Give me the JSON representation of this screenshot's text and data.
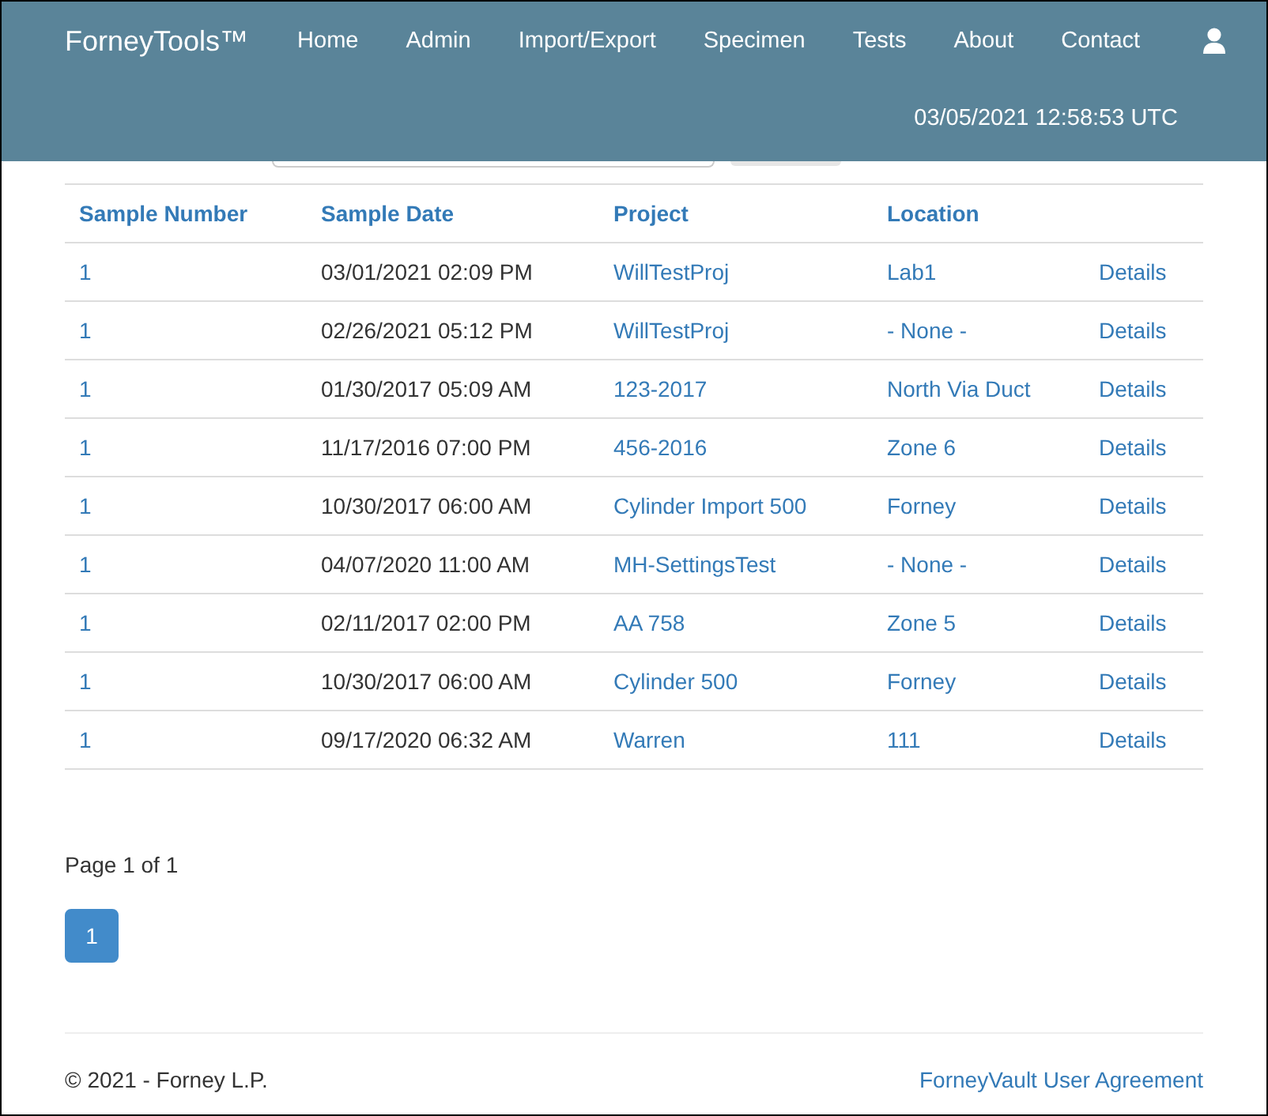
{
  "header": {
    "brand": "ForneyTools™",
    "nav": [
      "Home",
      "Admin",
      "Import/Export",
      "Specimen",
      "Tests",
      "About",
      "Contact"
    ],
    "timestamp": "03/05/2021 12:58:53 UTC"
  },
  "table": {
    "columns": [
      "Sample Number",
      "Sample Date",
      "Project",
      "Location"
    ],
    "rows": [
      {
        "number": "1",
        "date": "03/01/2021 02:09 PM",
        "project": "WillTestProj",
        "location": "Lab1",
        "action": "Details"
      },
      {
        "number": "1",
        "date": "02/26/2021 05:12 PM",
        "project": "WillTestProj",
        "location": "- None -",
        "action": "Details"
      },
      {
        "number": "1",
        "date": "01/30/2017 05:09 AM",
        "project": "123-2017",
        "location": "North Via Duct",
        "action": "Details"
      },
      {
        "number": "1",
        "date": "11/17/2016 07:00 PM",
        "project": "456-2016",
        "location": "Zone 6",
        "action": "Details"
      },
      {
        "number": "1",
        "date": "10/30/2017 06:00 AM",
        "project": "Cylinder Import 500",
        "location": "Forney",
        "action": "Details"
      },
      {
        "number": "1",
        "date": "04/07/2020 11:00 AM",
        "project": "MH-SettingsTest",
        "location": "- None -",
        "action": "Details"
      },
      {
        "number": "1",
        "date": "02/11/2017 02:00 PM",
        "project": "AA 758",
        "location": "Zone 5",
        "action": "Details"
      },
      {
        "number": "1",
        "date": "10/30/2017 06:00 AM",
        "project": "Cylinder 500",
        "location": "Forney",
        "action": "Details"
      },
      {
        "number": "1",
        "date": "09/17/2020 06:32 AM",
        "project": "Warren",
        "location": "111",
        "action": "Details"
      }
    ]
  },
  "pagination": {
    "summary": "Page 1 of 1",
    "pages": [
      {
        "label": "1",
        "selected": true
      }
    ]
  },
  "footer": {
    "copyright": "© 2021 - Forney L.P.",
    "link": "ForneyVault User Agreement"
  }
}
